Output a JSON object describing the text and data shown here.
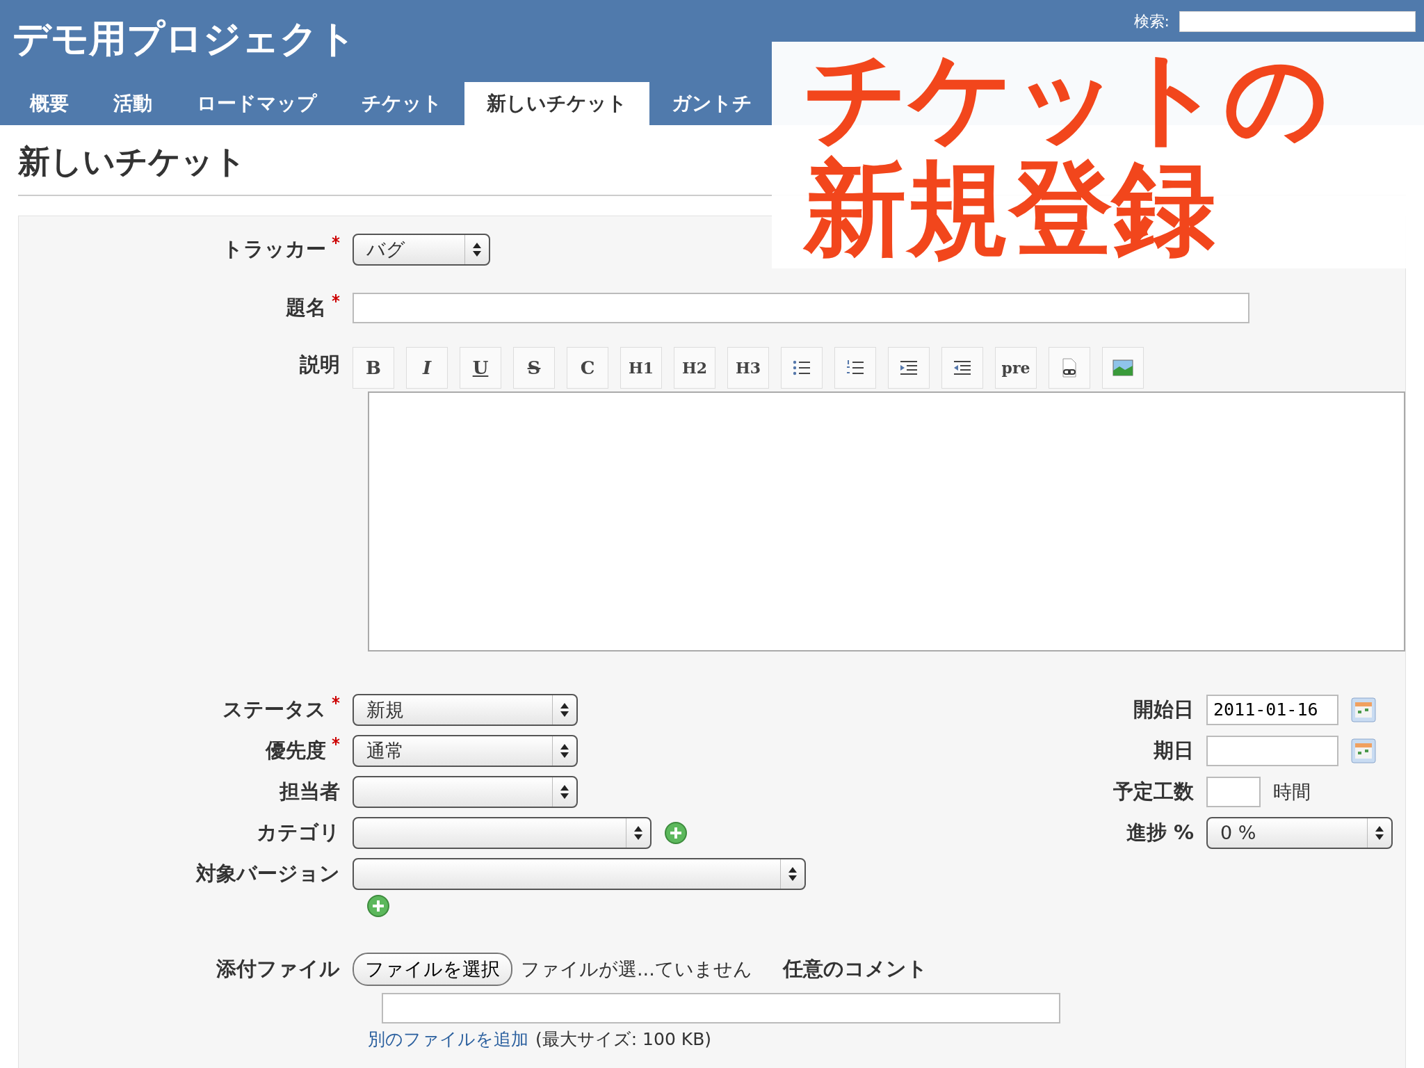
{
  "header": {
    "project_title": "デモ用プロジェクト",
    "search_label": "検索:"
  },
  "tabs": [
    {
      "label": "概要",
      "selected": false
    },
    {
      "label": "活動",
      "selected": false
    },
    {
      "label": "ロードマップ",
      "selected": false
    },
    {
      "label": "チケット",
      "selected": false
    },
    {
      "label": "新しいチケット",
      "selected": true
    },
    {
      "label": "ガントチ",
      "selected": false
    }
  ],
  "overlay_caption": [
    "チケットの",
    "新規登録"
  ],
  "page_title": "新しいチケット",
  "tracker": {
    "label": "トラッカー",
    "required": true,
    "value": "バグ"
  },
  "subject": {
    "label": "題名",
    "required": true
  },
  "description": {
    "label": "説明",
    "toolbar": [
      {
        "kind": "text",
        "label": "B"
      },
      {
        "kind": "text",
        "label": "I"
      },
      {
        "kind": "text",
        "label": "U"
      },
      {
        "kind": "text",
        "label": "S"
      },
      {
        "kind": "text",
        "label": "C"
      },
      {
        "kind": "text",
        "label": "H1"
      },
      {
        "kind": "text",
        "label": "H2"
      },
      {
        "kind": "text",
        "label": "H3"
      },
      {
        "kind": "bullets"
      },
      {
        "kind": "numbers"
      },
      {
        "kind": "indent"
      },
      {
        "kind": "outdent"
      },
      {
        "kind": "text",
        "label": "pre"
      },
      {
        "kind": "link"
      },
      {
        "kind": "image"
      }
    ]
  },
  "left_fields": [
    {
      "label": "ステータス",
      "required": true,
      "value": "新規"
    },
    {
      "label": "優先度",
      "required": true,
      "value": "通常"
    },
    {
      "label": "担当者",
      "required": false
    },
    {
      "label": "カテゴリ",
      "required": false,
      "add_button_inline": true
    },
    {
      "label": "対象バージョン",
      "required": false,
      "add_button_below": true
    }
  ],
  "right_fields": [
    {
      "kind": "date",
      "label": "開始日",
      "value": "2011-01-16"
    },
    {
      "kind": "date",
      "label": "期日"
    },
    {
      "kind": "hours",
      "label": "予定工数",
      "unit": "時間"
    },
    {
      "kind": "select",
      "label": "進捗 %",
      "value": "0 %"
    }
  ],
  "attachments": {
    "label": "添付ファイル",
    "choose_button": "ファイルを選択",
    "no_file": "ファイルが選...ていません",
    "comment_label": "任意のコメント",
    "add_link": "別のファイルを追加",
    "max_size": "(最大サイズ: 100 KB)"
  }
}
